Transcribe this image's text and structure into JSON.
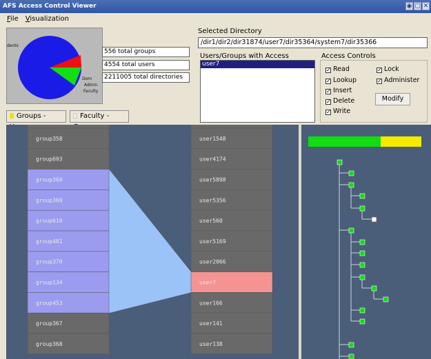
{
  "window": {
    "title": "AFS Access Control Viewer",
    "buttons": [
      "◉",
      "▢",
      "✕"
    ]
  },
  "menu": [
    "File",
    "Visualization"
  ],
  "pie_labels": [
    "dents",
    "Dom",
    "Admin",
    "Faculty"
  ],
  "stats": {
    "groups": "556 total groups",
    "users": "4554 total users",
    "dirs": "2211005 total directories"
  },
  "tabs": {
    "groups_users": "Groups - Users",
    "faculty_groups": "Faculty - Groups"
  },
  "selected_dir": {
    "label": "Selected Directory",
    "path": "/dir1/dir2/dir31874/user7/dir35364/system7/dir35366"
  },
  "access_list": {
    "label": "Users/Groups with Access",
    "items": [
      "user7"
    ]
  },
  "access_controls": {
    "label": "Access Controls",
    "read": "Read",
    "lookup": "Lookup",
    "insert": "Insert",
    "delete": "Delete",
    "write": "Write",
    "lock": "Lock",
    "administer": "Administer",
    "modify": "Modify"
  },
  "groups": [
    "group358",
    "group693",
    "group360",
    "group369",
    "group610",
    "group481",
    "group370",
    "group134",
    "group453",
    "group367",
    "group368"
  ],
  "users": [
    "user1548",
    "user4174",
    "user5898",
    "user5356",
    "user560",
    "user5169",
    "user2066",
    "user7",
    "user166",
    "user141",
    "user138"
  ],
  "highlighted_groups": [
    "group360",
    "group369",
    "group610",
    "group481",
    "group370",
    "group134",
    "group453"
  ],
  "selected_user": "user7",
  "colors": {
    "pie_blue": "#1b1be8",
    "pie_red": "#ee1111",
    "pie_green": "#13dd13",
    "group_cell": "#696969",
    "group_highlight": "#9b9bf0",
    "user_highlight": "#f59393",
    "fan": "#9bc3f7",
    "tree_node": "#11dd11",
    "bar_yellow": "#f5ea00"
  },
  "usage_bar": {
    "green_fraction": 0.64
  }
}
